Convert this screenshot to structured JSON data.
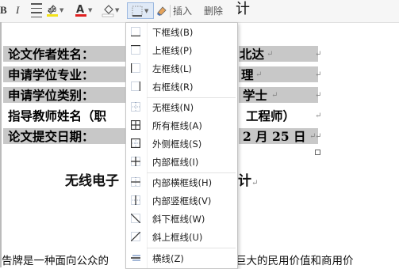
{
  "toolbar": {
    "bold": "B",
    "italic": "I",
    "insert_label": "插入",
    "delete_label": "删除",
    "title_fragment": "计"
  },
  "document": {
    "rows": [
      {
        "label": "论文作者姓名：",
        "value": "北达"
      },
      {
        "label": "申请学位专业：",
        "value": "理"
      },
      {
        "label": "申请学位类别：",
        "value": "学士"
      },
      {
        "label": "指导教师姓名（职",
        "value": "工程师）"
      },
      {
        "label": "论文提交日期：",
        "value": "2 月 25 日"
      }
    ],
    "paragraph_mark": "↵",
    "heading_left": "无线电子",
    "heading_right": "计",
    "para_left": "告牌是一种面向公众的",
    "para_right": "巨大的民用价值和商用价"
  },
  "border_menu": {
    "items": [
      {
        "label": "下框线(B)",
        "icon": "bottom-border-icon"
      },
      {
        "label": "上框线(P)",
        "icon": "top-border-icon"
      },
      {
        "label": "左框线(L)",
        "icon": "left-border-icon"
      },
      {
        "label": "右框线(R)",
        "icon": "right-border-icon"
      },
      {
        "label": "无框线(N)",
        "icon": "no-border-icon"
      },
      {
        "label": "所有框线(A)",
        "icon": "all-borders-icon"
      },
      {
        "label": "外侧框线(S)",
        "icon": "outside-borders-icon"
      },
      {
        "label": "内部框线(I)",
        "icon": "inside-borders-icon"
      },
      {
        "label": "内部横框线(H)",
        "icon": "inside-horizontal-border-icon"
      },
      {
        "label": "内部竖框线(V)",
        "icon": "inside-vertical-border-icon"
      },
      {
        "label": "斜下框线(W)",
        "icon": "diagonal-down-border-icon"
      },
      {
        "label": "斜上框线(U)",
        "icon": "diagonal-up-border-icon"
      },
      {
        "label": "横线(Z)",
        "icon": "horizontal-line-icon"
      }
    ]
  },
  "colors": {
    "highlight_gray": "#c8c8c8",
    "font_color_red": "#e02020",
    "highlighter_yellow": "#f2e21a",
    "menu_icon_blue": "#4a72b0"
  }
}
